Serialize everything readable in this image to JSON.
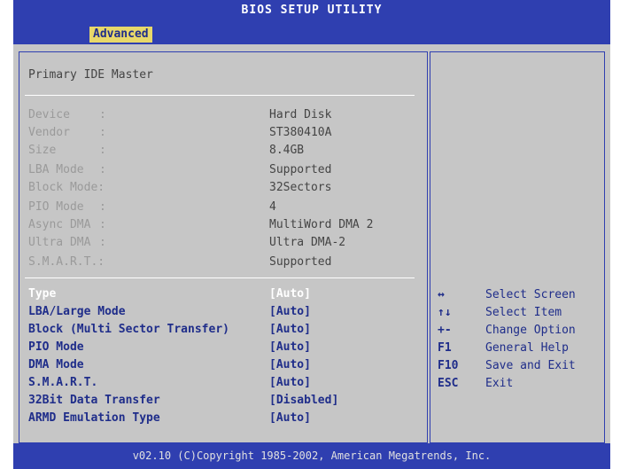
{
  "title": "BIOS SETUP UTILITY",
  "active_tab": "Advanced",
  "section_title": "Primary IDE Master",
  "info_rows": [
    {
      "label": "Device",
      "colon": ":",
      "value": "Hard Disk"
    },
    {
      "label": "Vendor",
      "colon": ":",
      "value": "ST380410A"
    },
    {
      "label": "Size",
      "colon": ":",
      "value": "8.4GB"
    },
    {
      "label": "LBA Mode",
      "colon": ":",
      "value": "Supported"
    },
    {
      "label": "Block Mode:",
      "colon": "",
      "value": "32Sectors"
    },
    {
      "label": "PIO Mode",
      "colon": ":",
      "value": "4"
    },
    {
      "label": "Async DMA",
      "colon": ":",
      "value": "MultiWord DMA 2"
    },
    {
      "label": "Ultra DMA",
      "colon": ":",
      "value": "Ultra DMA-2"
    },
    {
      "label": "S.M.A.R.T.:",
      "colon": "",
      "value": "Supported"
    }
  ],
  "options": [
    {
      "label": "Type",
      "value": "[Auto]"
    },
    {
      "label": "LBA/Large Mode",
      "value": "[Auto]"
    },
    {
      "label": "Block (Multi Sector Transfer)",
      "value": "[Auto]"
    },
    {
      "label": "PIO Mode",
      "value": "[Auto]"
    },
    {
      "label": "DMA Mode",
      "value": "[Auto]"
    },
    {
      "label": "S.M.A.R.T.",
      "value": "[Auto]"
    },
    {
      "label": "32Bit Data Transfer",
      "value": "[Disabled]"
    },
    {
      "label": "ARMD Emulation Type",
      "value": "[Auto]"
    }
  ],
  "help": [
    {
      "key": "↔",
      "text": "Select Screen"
    },
    {
      "key": "↑↓",
      "text": "Select Item"
    },
    {
      "key": "+-",
      "text": "Change Option"
    },
    {
      "key": "F1",
      "text": "General Help"
    },
    {
      "key": "F10",
      "text": "Save and Exit"
    },
    {
      "key": "ESC",
      "text": "Exit"
    }
  ],
  "footer": "v02.10 (C)Copyright 1985-2002, American Megatrends, Inc.",
  "colors": {
    "frame": "#2f3fb0",
    "panel": "#c6c6c6",
    "active_tab_bg": "#e8d86a",
    "option_text": "#1f2d8a",
    "info_text": "#9a9a9a"
  }
}
